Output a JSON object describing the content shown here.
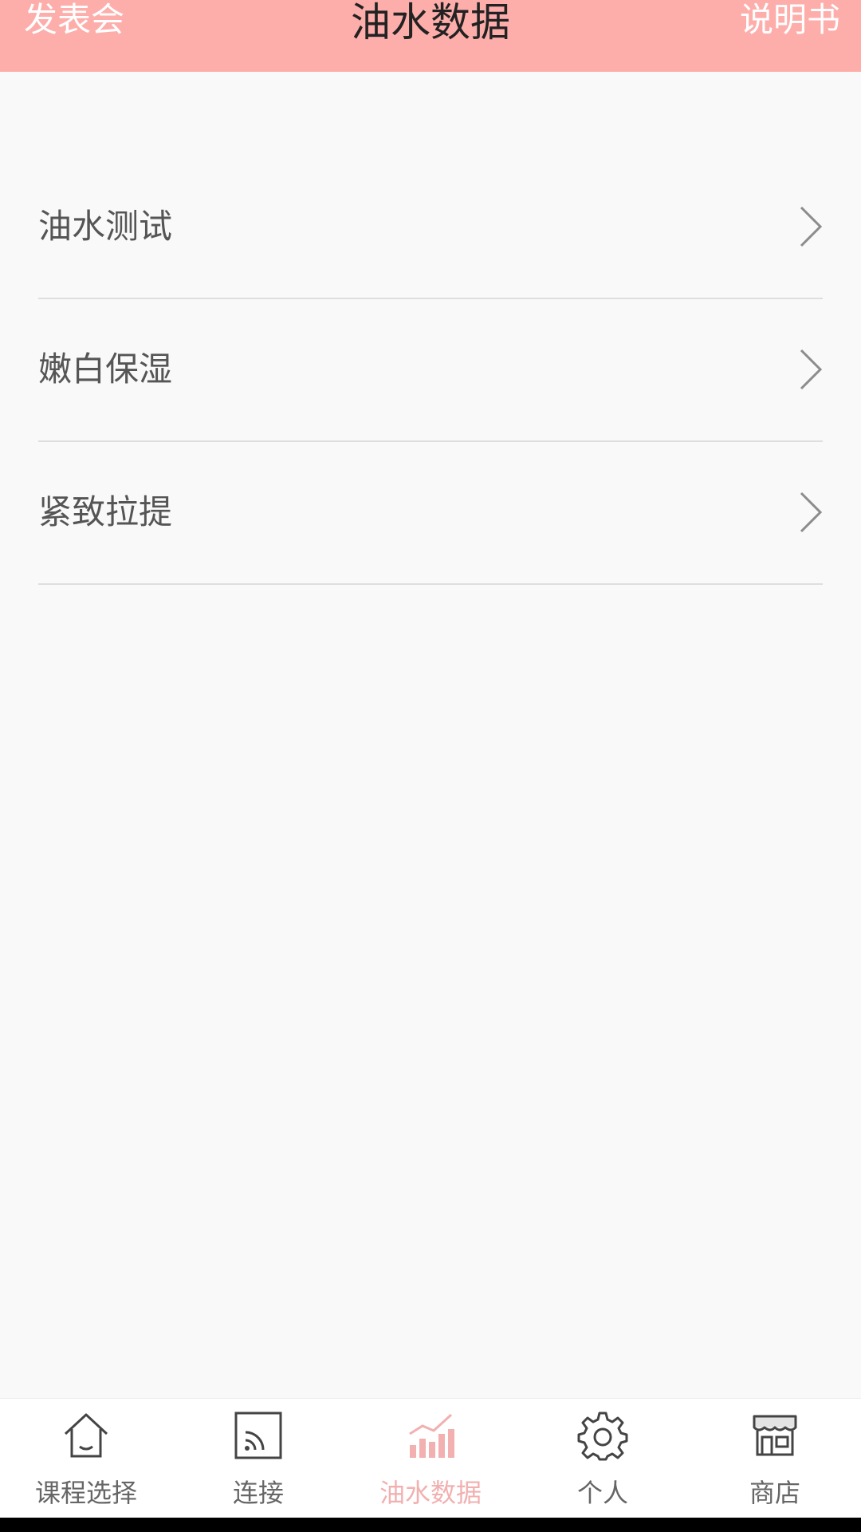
{
  "header": {
    "left_label": "发表会",
    "title": "油水数据",
    "right_label": "说明书",
    "bg_color": "#fdaeab"
  },
  "menu": {
    "items": [
      {
        "label": "油水测试",
        "icon": "chevron-right-icon"
      },
      {
        "label": "嫩白保湿",
        "icon": "chevron-right-icon"
      },
      {
        "label": "紧致拉提",
        "icon": "chevron-right-icon"
      }
    ]
  },
  "tabbar": {
    "active_index": 2,
    "active_color": "#f2b0b0",
    "items": [
      {
        "label": "课程选择",
        "icon": "home-icon"
      },
      {
        "label": "连接",
        "icon": "cast-icon"
      },
      {
        "label": "油水数据",
        "icon": "chart-icon"
      },
      {
        "label": "个人",
        "icon": "gear-icon"
      },
      {
        "label": "商店",
        "icon": "store-icon"
      }
    ]
  }
}
